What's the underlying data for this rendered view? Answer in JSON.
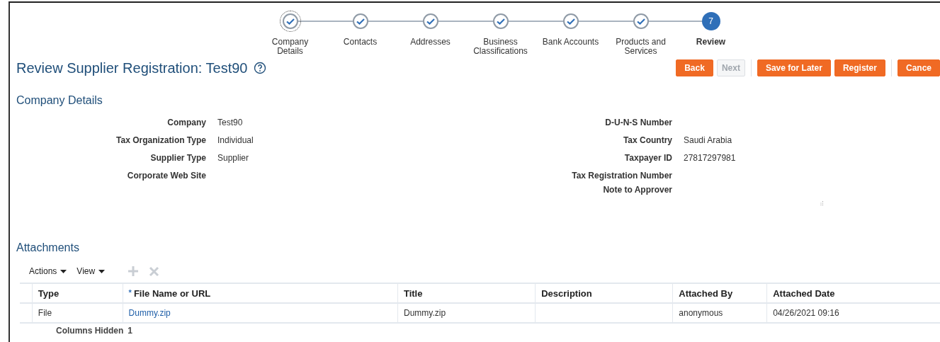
{
  "train": [
    {
      "label": "Company Details",
      "completed": true,
      "focused": true
    },
    {
      "label": "Contacts",
      "completed": true,
      "focused": false
    },
    {
      "label": "Addresses",
      "completed": true,
      "focused": false
    },
    {
      "label": "Business Classifications",
      "completed": true,
      "focused": false
    },
    {
      "label": "Bank Accounts",
      "completed": true,
      "focused": false
    },
    {
      "label": "Products and Services",
      "completed": true,
      "focused": false
    },
    {
      "label": "Review",
      "number": "7",
      "completed": false,
      "focused": false
    }
  ],
  "title": "Review Supplier Registration: Test90",
  "buttons": [
    {
      "label": "Back",
      "disabled": false
    },
    {
      "label": "Next",
      "disabled": true
    },
    {
      "label": "Save for Later",
      "disabled": false
    },
    {
      "label": "Register",
      "disabled": false
    },
    {
      "label": "Cance",
      "disabled": false
    }
  ],
  "company_details": {
    "heading": "Company Details",
    "left": [
      {
        "label": "Company",
        "value": "Test90"
      },
      {
        "label": "Tax Organization Type",
        "value": "Individual"
      },
      {
        "label": "Supplier Type",
        "value": "Supplier"
      },
      {
        "label": "Corporate Web Site"
      }
    ],
    "right": [
      {
        "label": "D-U-N-S Number"
      },
      {
        "label": "Tax Country",
        "value": "Saudi Arabia"
      },
      {
        "label": "Taxpayer ID",
        "value": "27817297981"
      },
      {
        "label": "Tax Registration Number"
      },
      {
        "label": "Note to Approver"
      }
    ]
  },
  "attachments": {
    "heading": "Attachments",
    "menus": [
      "Actions",
      "View"
    ],
    "columns": [
      {
        "label": "Type"
      },
      {
        "label": "File Name or URL",
        "required_mark": "*"
      },
      {
        "label": "Title"
      },
      {
        "label": "Description"
      },
      {
        "label": "Attached By"
      },
      {
        "label": "Attached Date"
      }
    ],
    "rows": [
      {
        "type": "File",
        "file_name": "Dummy.zip",
        "title": "Dummy.zip",
        "attached_by": "anonymous",
        "attached_date": "04/26/2021 09:16"
      }
    ],
    "columns_hidden_label": "Columns Hidden",
    "columns_hidden_count": "1"
  }
}
